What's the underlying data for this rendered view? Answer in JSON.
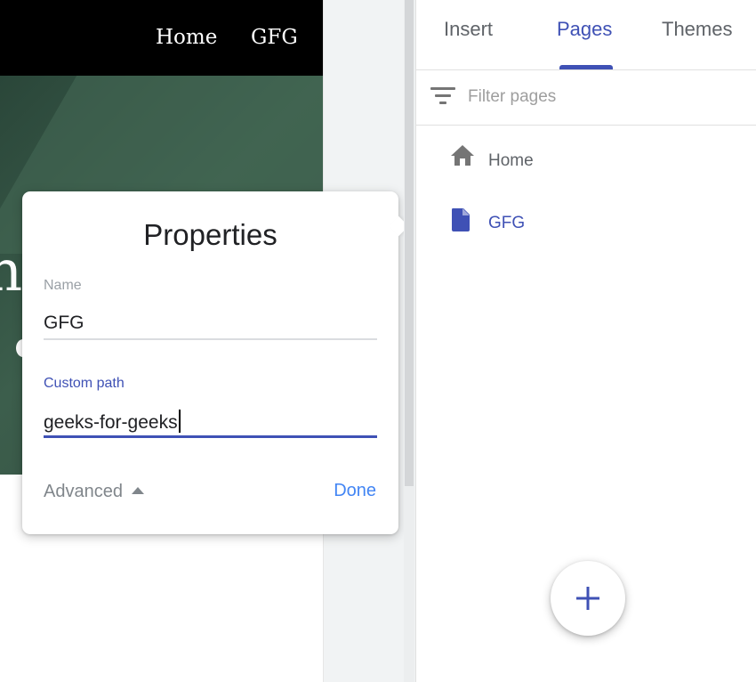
{
  "site": {
    "nav": {
      "home": "Home",
      "gfg": "GFG"
    },
    "hero_glyph": "n"
  },
  "properties_dialog": {
    "title": "Properties",
    "name_label": "Name",
    "name_value": "GFG",
    "custom_path_label": "Custom path",
    "custom_path_value": "geeks-for-geeks",
    "advanced_label": "Advanced",
    "done_label": "Done"
  },
  "side_panel": {
    "tabs": [
      {
        "label": "Insert",
        "active": false
      },
      {
        "label": "Pages",
        "active": true
      },
      {
        "label": "Themes",
        "active": false
      }
    ],
    "filter_placeholder": "Filter pages",
    "pages": [
      {
        "label": "Home",
        "icon": "home-icon",
        "selected": false
      },
      {
        "label": "GFG",
        "icon": "page-icon",
        "selected": true
      }
    ],
    "add_button_icon": "plus-icon"
  },
  "colors": {
    "accent": "#3f51b5",
    "done_link": "#4285f4",
    "nav_bar": "#000000",
    "hero": "#3a5a49"
  }
}
